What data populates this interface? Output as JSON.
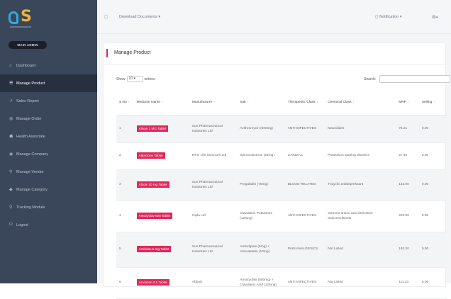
{
  "sidebar": {
    "badge": "MAIN ADMIN",
    "items": [
      {
        "label": "Dashboard",
        "icon": "home-icon",
        "glyph": "⌂"
      },
      {
        "label": "Manage Product",
        "icon": "list-icon",
        "glyph": "☰"
      },
      {
        "label": "Sales Report",
        "icon": "chart-icon",
        "glyph": "↗"
      },
      {
        "label": "Manage Order",
        "icon": "cart-icon",
        "glyph": "◍"
      },
      {
        "label": "Health Associate",
        "icon": "users-icon",
        "glyph": "☗"
      },
      {
        "label": "Manage Company",
        "icon": "pin-icon",
        "glyph": "◉"
      },
      {
        "label": "Manage Vendor",
        "icon": "vendor-icon",
        "glyph": "⚲"
      },
      {
        "label": "Manage Category",
        "icon": "tag-icon",
        "glyph": "◆"
      },
      {
        "label": "Tracking Module",
        "icon": "track-icon",
        "glyph": "⚲"
      },
      {
        "label": "Logout",
        "icon": "logout-icon",
        "glyph": "⏻"
      }
    ]
  },
  "topbar": {
    "download": "Download Documents",
    "notifications": "Notification",
    "menu_glyph": "☐",
    "gear_glyph": "⚙"
  },
  "main": {
    "title": "Manage Product",
    "show_label": "Show",
    "show_value": "10",
    "entries_label": "entries",
    "search_label": "Search:",
    "search_placeholder": ""
  },
  "table": {
    "columns": [
      "S.No",
      "Medicine Name",
      "Manufacturer",
      "Salt",
      "Therapeutic Class",
      "Chemical Class",
      "MRP",
      "Selling"
    ],
    "rows": [
      {
        "no": "1",
        "name": "Ativan 1 MG Tablet",
        "mfr": "Sun Pharmaceutical Industries Ltd",
        "salt": "Azithromycin (500mg)",
        "ther": "ANTI INFECTIVES",
        "chem": "Macrolides",
        "mrp": "75.21",
        "sell": "0.00"
      },
      {
        "no": "2",
        "name": "Aldactone Tablet",
        "mfr": "RPG Life Sciences Ltd",
        "salt": "Spironolactone (25mg)",
        "ther": "CARDIAC",
        "chem": "Potassium sparing diuretics",
        "mrp": "27.40",
        "sell": "0.00"
      },
      {
        "no": "3",
        "name": "Alzole 10 mg Tablet",
        "mfr": "Sun Pharmaceutical Industries Ltd",
        "salt": "Pregabalin (75mg)",
        "ther": "BLOOD RELATED",
        "chem": "Tricyclic antidepressant",
        "mrp": "123.00",
        "sell": "0.00"
      },
      {
        "no": "4",
        "name": "Amoxyclav 625 Tablet",
        "mfr": "Cipla Ltd",
        "salt": "Clavulanic Potassium (125mg)",
        "ther": "ANTI INFECTIVES",
        "chem": "Gamma amino acid derivative anticonvulsants",
        "mrp": "223.00",
        "sell": "0.00"
      },
      {
        "no": "5",
        "name": "Amlodac 5 mg Tablet",
        "mfr": "Sun Pharmaceutical Industries Ltd",
        "salt": "Amlodipine (5mg) + Atorvastatin (10mg)",
        "ther": "PAIN ANALGESICS",
        "chem": "Not Listed",
        "mrp": "192.20",
        "sell": "0.00"
      },
      {
        "no": "6",
        "name": "Anxiozen 0.5 Tablet",
        "mfr": "Abbott",
        "salt": "Amoxycillin (500mg) + Clavulanic Acid (125mg)",
        "ther": "ANTI INFECTIVES",
        "chem": "Not Listed",
        "mrp": "111.23",
        "sell": "0.00"
      }
    ]
  },
  "colors": {
    "sidebar": "#3a475a",
    "sidebar_active": "#26303f",
    "accent": "#e2275b",
    "logo_blue": "#35a9d8",
    "logo_orange": "#f0b43a"
  }
}
